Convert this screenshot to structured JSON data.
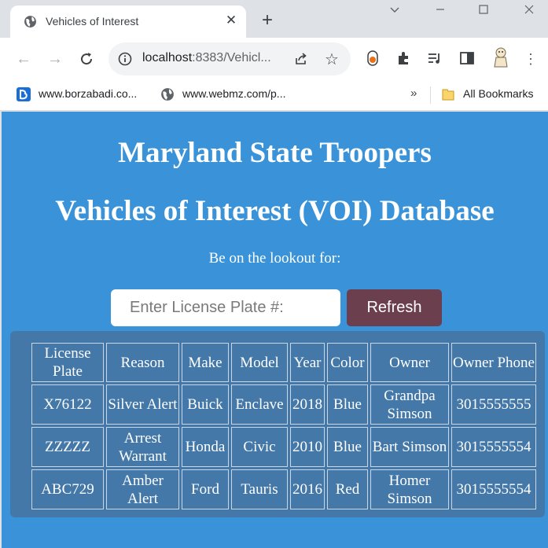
{
  "browser": {
    "tab": {
      "title": "Vehicles of Interest",
      "favicon": "globe-icon"
    },
    "new_tab_symbol": "+",
    "window_controls": [
      "chevron-down-icon",
      "minimize-icon",
      "maximize-icon",
      "close-icon"
    ],
    "address": {
      "host": "localhost",
      "rest": ":8383/Vehicl..."
    },
    "bookmarks": [
      {
        "label": "www.borzabadi.co...",
        "icon": "bookmark-site-icon"
      },
      {
        "label": "www.webmz.com/p...",
        "icon": "globe-icon"
      }
    ],
    "bookmarks_more": "»",
    "all_bookmarks": "All Bookmarks"
  },
  "page": {
    "title_line1": "Maryland State Troopers",
    "title_line2": "Vehicles of Interest (VOI) Database",
    "lookout_text": "Be on the lookout for:",
    "plate_input": {
      "placeholder": "Enter License Plate #:",
      "value": ""
    },
    "refresh_label": "Refresh",
    "colors": {
      "background": "#3a93d9",
      "panel": "#4378a8",
      "button": "#6b3f4e"
    },
    "table": {
      "headers": [
        "License Plate",
        "Reason",
        "Make",
        "Model",
        "Year",
        "Color",
        "Owner",
        "Owner Phone"
      ],
      "rows": [
        [
          "X76122",
          "Silver Alert",
          "Buick",
          "Enclave",
          "2018",
          "Blue",
          "Grandpa Simson",
          "3015555555"
        ],
        [
          "ZZZZZ",
          "Arrest Warrant",
          "Honda",
          "Civic",
          "2010",
          "Blue",
          "Bart Simson",
          "3015555554"
        ],
        [
          "ABC729",
          "Amber Alert",
          "Ford",
          "Tauris",
          "2016",
          "Red",
          "Homer Simson",
          "3015555554"
        ]
      ]
    }
  }
}
